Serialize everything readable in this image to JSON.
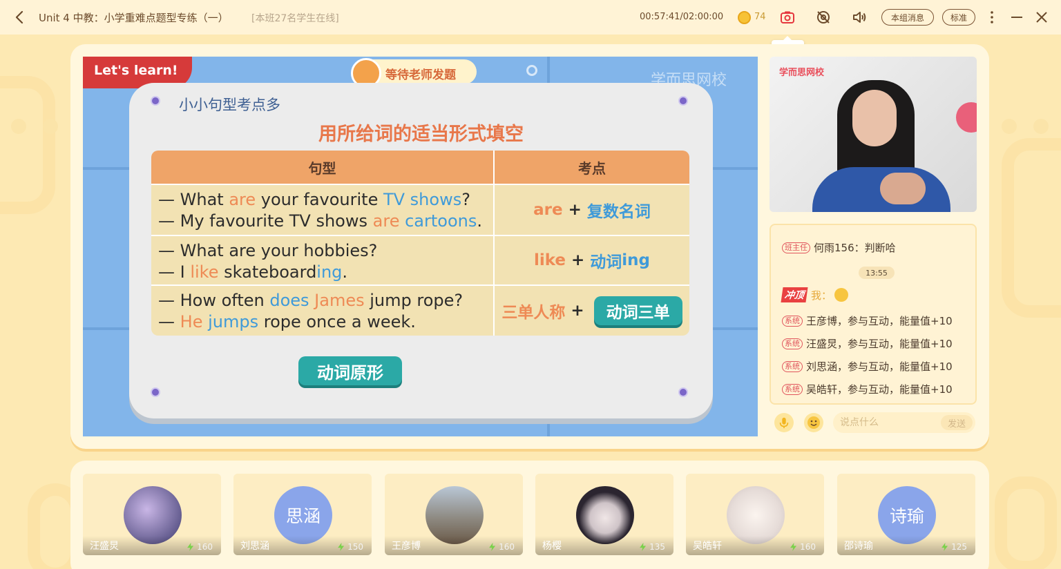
{
  "header": {
    "title": "Unit 4 中教：小学重难点题型专练（一）",
    "online_text": "[本班27名学生在线]",
    "timer": "00:57:41/02:00:00",
    "coin_count": "74",
    "group_msg_label": "本组消息",
    "quality_label": "标准",
    "screenshot_tooltip": "截屏"
  },
  "slide": {
    "corner_label": "Let's learn!",
    "wait_label": "等待老师发题",
    "watermark": "学而思网校",
    "subtitle": "小小句型考点多",
    "title": "用所给词的适当形式填空",
    "table_headers": [
      "句型",
      "考点"
    ],
    "rows": [
      {
        "line1": [
          "— What ",
          "are",
          " your favourite ",
          "TV shows",
          "?"
        ],
        "line2": [
          "— My favourite TV shows ",
          "are",
          " ",
          "cartoons",
          "."
        ],
        "point": [
          "are",
          " + ",
          "复数名词"
        ]
      },
      {
        "line1": [
          "— What are your hobbies?"
        ],
        "line2": [
          "— I ",
          "like",
          " skateboard",
          "ing",
          "."
        ],
        "point": [
          "like",
          " + ",
          "动词",
          "ing"
        ]
      },
      {
        "line1": [
          "— How often ",
          "does",
          " ",
          "James",
          " jump rope?"
        ],
        "line2": [
          "— ",
          "He",
          " ",
          "jumps",
          " rope once a week."
        ],
        "point": [
          "三单人称",
          " + ",
          "动词三单"
        ]
      }
    ],
    "bottom_button": "动词原形"
  },
  "video": {
    "watermark": "学而思网校"
  },
  "chat": {
    "messages": [
      {
        "tag": "班主任",
        "text": "何雨156：判断哈"
      },
      {
        "time": "13:55"
      },
      {
        "badge": "冲顶",
        "text": "我："
      },
      {
        "tag": "系统",
        "text": "王彦博，参与互动，能量值+10"
      },
      {
        "tag": "系统",
        "text": "汪盛炅，参与互动，能量值+10"
      },
      {
        "tag": "系统",
        "text": "刘思涵，参与互动，能量值+10"
      },
      {
        "tag": "系统",
        "text": "吴皓轩，参与互动，能量值+10"
      }
    ],
    "input_placeholder": "说点什么",
    "send_label": "发送"
  },
  "students": [
    {
      "name": "汪盛炅",
      "score": "160",
      "avatar_text": ""
    },
    {
      "name": "刘思涵",
      "score": "150",
      "avatar_text": "思涵"
    },
    {
      "name": "王彦博",
      "score": "160",
      "avatar_text": ""
    },
    {
      "name": "杨樱",
      "score": "135",
      "avatar_text": ""
    },
    {
      "name": "吴皓轩",
      "score": "160",
      "avatar_text": ""
    },
    {
      "name": "邵诗瑜",
      "score": "125",
      "avatar_text": "诗瑜"
    }
  ],
  "colors": {
    "accent_orange": "#ee8a55",
    "accent_blue": "#3f9ad9",
    "teal": "#2ba9a6",
    "background": "#fde9b3"
  }
}
